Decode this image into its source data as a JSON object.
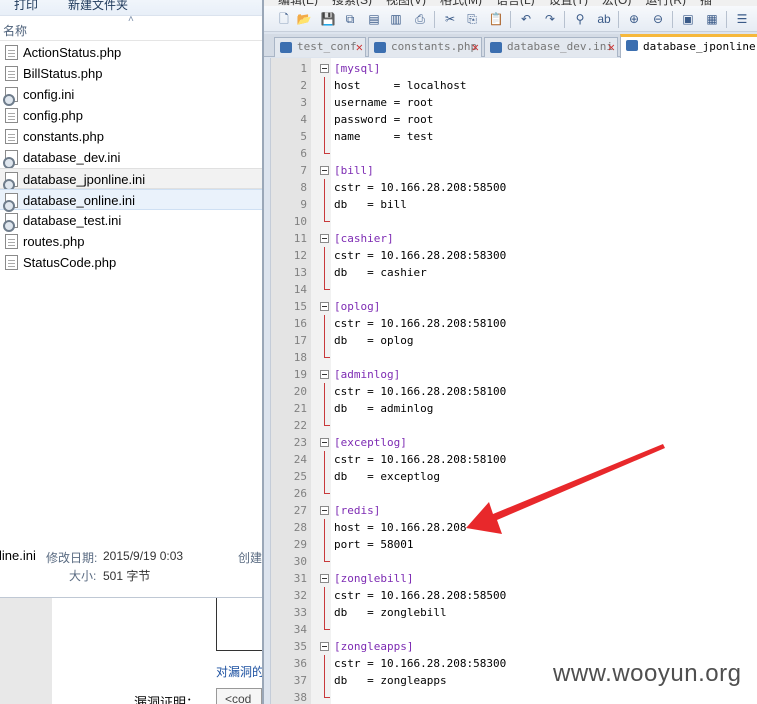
{
  "explorer": {
    "toolbar": {
      "print": "打印",
      "new_folder": "新建文件夹"
    },
    "column_name": "名称",
    "sort_arrow": "˄",
    "files": [
      {
        "name": "ActionStatus.php",
        "type": "php"
      },
      {
        "name": "BillStatus.php",
        "type": "php"
      },
      {
        "name": "config.ini",
        "type": "ini"
      },
      {
        "name": "config.php",
        "type": "php"
      },
      {
        "name": "constants.php",
        "type": "php"
      },
      {
        "name": "database_dev.ini",
        "type": "ini"
      },
      {
        "name": "database_jponline.ini",
        "type": "ini"
      },
      {
        "name": "database_online.ini",
        "type": "ini"
      },
      {
        "name": "database_test.ini",
        "type": "ini"
      },
      {
        "name": "routes.php",
        "type": "php"
      },
      {
        "name": "StatusCode.php",
        "type": "php"
      }
    ],
    "details": {
      "filename_fragment": "line.ini",
      "modified_label": "修改日期:",
      "modified_value": "2015/9/19 0:03",
      "created_label": "创建",
      "size_label": "大小:",
      "size_value": "501 字节"
    },
    "page_behind": {
      "link_text": "对漏洞的",
      "proof_label": "漏洞证明：",
      "input_fragment": "<cod"
    }
  },
  "editor": {
    "menu": [
      "编辑(E)",
      "搜索(S)",
      "视图(V)",
      "格式(M)",
      "语言(L)",
      "设置(T)",
      "宏(O)",
      "运行(R)",
      "插"
    ],
    "tabs": [
      {
        "label": "test_conf",
        "active": false
      },
      {
        "label": "constants.php",
        "active": false
      },
      {
        "label": "database_dev.ini",
        "active": false
      },
      {
        "label": "database_jponline.i",
        "active": true
      }
    ],
    "lines": [
      {
        "n": "1",
        "kind": "section",
        "text": "[mysql]"
      },
      {
        "n": "2",
        "kind": "kv",
        "key": "host     ",
        "value": "localhost"
      },
      {
        "n": "3",
        "kind": "kv",
        "key": "username ",
        "value": "root"
      },
      {
        "n": "4",
        "kind": "kv",
        "key": "password ",
        "value": "root"
      },
      {
        "n": "5",
        "kind": "kv",
        "key": "name     ",
        "value": "test"
      },
      {
        "n": "6",
        "kind": "end"
      },
      {
        "n": "7",
        "kind": "section",
        "text": "[bill]"
      },
      {
        "n": "8",
        "kind": "kv",
        "key": "cstr ",
        "value": "10.166.28.208:58500"
      },
      {
        "n": "9",
        "kind": "kv",
        "key": "db   ",
        "value": "bill"
      },
      {
        "n": "10",
        "kind": "end"
      },
      {
        "n": "11",
        "kind": "section",
        "text": "[cashier]"
      },
      {
        "n": "12",
        "kind": "kv",
        "key": "cstr ",
        "value": "10.166.28.208:58300"
      },
      {
        "n": "13",
        "kind": "kv",
        "key": "db   ",
        "value": "cashier"
      },
      {
        "n": "14",
        "kind": "end"
      },
      {
        "n": "15",
        "kind": "section",
        "text": "[oplog]"
      },
      {
        "n": "16",
        "kind": "kv",
        "key": "cstr ",
        "value": "10.166.28.208:58100"
      },
      {
        "n": "17",
        "kind": "kv",
        "key": "db   ",
        "value": "oplog"
      },
      {
        "n": "18",
        "kind": "end"
      },
      {
        "n": "19",
        "kind": "section",
        "text": "[adminlog]"
      },
      {
        "n": "20",
        "kind": "kv",
        "key": "cstr ",
        "value": "10.166.28.208:58100"
      },
      {
        "n": "21",
        "kind": "kv",
        "key": "db   ",
        "value": "adminlog"
      },
      {
        "n": "22",
        "kind": "end"
      },
      {
        "n": "23",
        "kind": "section",
        "text": "[exceptlog]"
      },
      {
        "n": "24",
        "kind": "kv",
        "key": "cstr ",
        "value": "10.166.28.208:58100"
      },
      {
        "n": "25",
        "kind": "kv",
        "key": "db   ",
        "value": "exceptlog"
      },
      {
        "n": "26",
        "kind": "end"
      },
      {
        "n": "27",
        "kind": "section",
        "text": "[redis]"
      },
      {
        "n": "28",
        "kind": "kv",
        "key": "host ",
        "value": "10.166.28.208"
      },
      {
        "n": "29",
        "kind": "kv",
        "key": "port ",
        "value": "58001"
      },
      {
        "n": "30",
        "kind": "end"
      },
      {
        "n": "31",
        "kind": "section",
        "text": "[zonglebill]"
      },
      {
        "n": "32",
        "kind": "kv",
        "key": "cstr ",
        "value": "10.166.28.208:58500"
      },
      {
        "n": "33",
        "kind": "kv",
        "key": "db   ",
        "value": "zonglebill"
      },
      {
        "n": "34",
        "kind": "end"
      },
      {
        "n": "35",
        "kind": "section",
        "text": "[zongleapps]"
      },
      {
        "n": "36",
        "kind": "kv",
        "key": "cstr ",
        "value": "10.166.28.208:58300"
      },
      {
        "n": "37",
        "kind": "kv",
        "key": "db   ",
        "value": "zongleapps"
      },
      {
        "n": "38",
        "kind": "end"
      }
    ]
  },
  "watermark": "www.wooyun.org",
  "colors": {
    "section": "#7d2bb3",
    "fold": "#c8393b",
    "arrow": "#e8282b",
    "active_tab_accent": "#f6b83c"
  }
}
